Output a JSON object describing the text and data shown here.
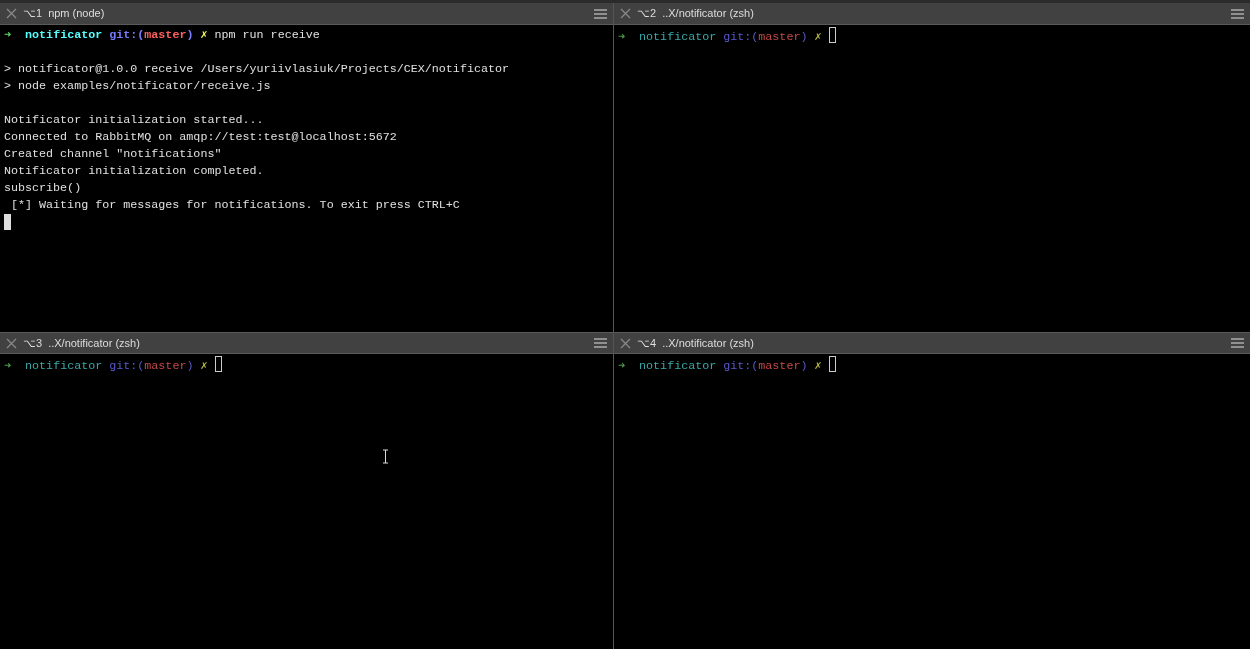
{
  "panes": [
    {
      "shortcut": "⌥1",
      "title": "npm (node)",
      "active": true,
      "prompt": [
        {
          "kind": "arrow",
          "text": "➜"
        },
        {
          "kind": "dir",
          "text": "notificator"
        },
        {
          "kind": "git",
          "text": "git:("
        },
        {
          "kind": "branch",
          "text": "master"
        },
        {
          "kind": "git",
          "text": ")"
        },
        {
          "kind": "dirty",
          "text": "✗"
        },
        {
          "kind": "cmd",
          "text": "npm run receive"
        }
      ],
      "output": [
        {
          "text": "> notificator@1.0.0 receive /Users/yuriivlasiuk/Projects/CEX/notificator",
          "gap_before": true
        },
        {
          "text": "> node examples/notificator/receive.js"
        },
        {
          "text": "Notificator initialization started...",
          "gap_before": true
        },
        {
          "text": "Connected to RabbitMQ on amqp://test:test@localhost:5672"
        },
        {
          "text": "Created channel \"notifications\""
        },
        {
          "text": "Notificator initialization completed."
        },
        {
          "text": "subscribe()"
        },
        {
          "text": " [*] Waiting for messages for notifications. To exit press CTRL+C"
        }
      ]
    },
    {
      "shortcut": "⌥2",
      "title": "..X/notificator (zsh)",
      "active": false,
      "prompt": [
        {
          "kind": "arrow",
          "text": "➜"
        },
        {
          "kind": "dir",
          "text": "notificator"
        },
        {
          "kind": "git",
          "text": "git:("
        },
        {
          "kind": "branch",
          "text": "master"
        },
        {
          "kind": "git",
          "text": ")"
        },
        {
          "kind": "dirty",
          "text": "✗"
        }
      ]
    },
    {
      "shortcut": "⌥3",
      "title": "..X/notificator (zsh)",
      "active": false,
      "prompt": [
        {
          "kind": "arrow",
          "text": "➜"
        },
        {
          "kind": "dir",
          "text": "notificator"
        },
        {
          "kind": "git",
          "text": "git:("
        },
        {
          "kind": "branch",
          "text": "master"
        },
        {
          "kind": "git",
          "text": ")"
        },
        {
          "kind": "dirty",
          "text": "✗"
        }
      ]
    },
    {
      "shortcut": "⌥4",
      "title": "..X/notificator (zsh)",
      "active": false,
      "prompt": [
        {
          "kind": "arrow",
          "text": "➜"
        },
        {
          "kind": "dir",
          "text": "notificator"
        },
        {
          "kind": "git",
          "text": "git:("
        },
        {
          "kind": "branch",
          "text": "master"
        },
        {
          "kind": "git",
          "text": ")"
        },
        {
          "kind": "dirty",
          "text": "✗"
        }
      ]
    }
  ]
}
